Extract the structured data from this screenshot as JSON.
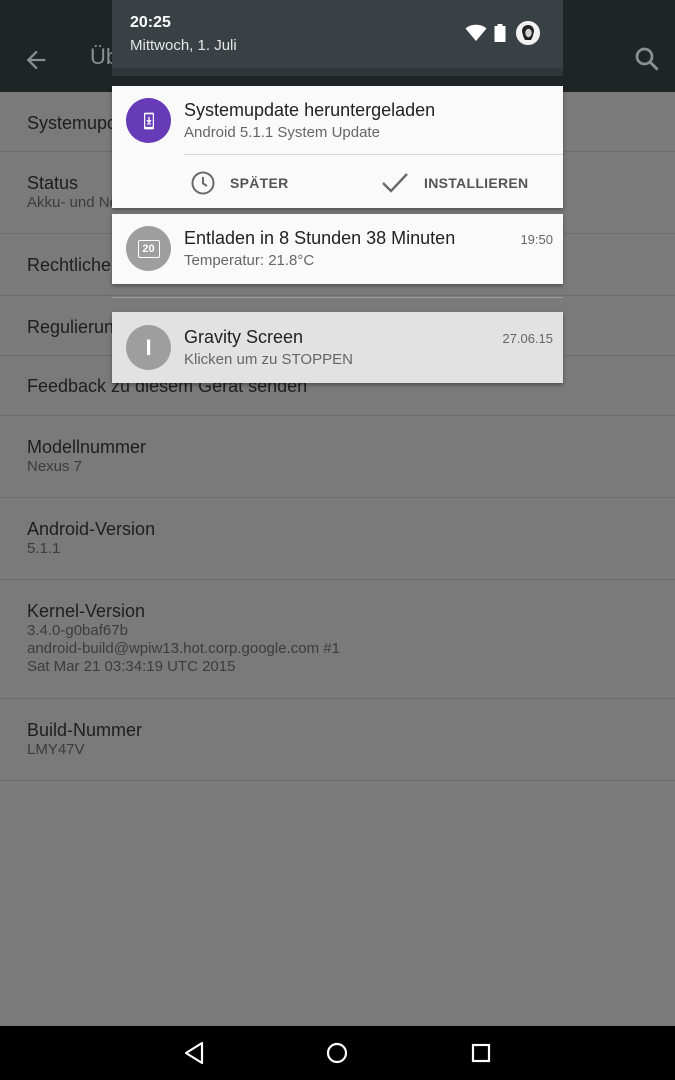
{
  "background_screen": {
    "title": "Üb",
    "items": [
      {
        "title": "Systemupd",
        "subtitle": ""
      },
      {
        "title": "Status",
        "subtitle": "Akku- und Netzwerkstatus und andere Informationen"
      },
      {
        "title": "Rechtliche",
        "subtitle": ""
      },
      {
        "title": "Regulierun",
        "subtitle": ""
      },
      {
        "title": "Feedback zu diesem Gerät senden",
        "subtitle": ""
      },
      {
        "title": "Modellnummer",
        "subtitle": "Nexus 7"
      },
      {
        "title": "Android-Version",
        "subtitle": "5.1.1"
      },
      {
        "title": "Kernel-Version",
        "subtitle": "3.4.0-g0baf67b",
        "subtitle2": "android-build@wpiw13.hot.corp.google.com #1",
        "subtitle3": "Sat Mar 21 03:34:19 UTC 2015"
      },
      {
        "title": "Build-Nummer",
        "subtitle": "LMY47V"
      }
    ]
  },
  "status": {
    "time": "20:25",
    "date": "Mittwoch, 1. Juli"
  },
  "notifications": {
    "update": {
      "title": "Systemupdate heruntergeladen",
      "subtitle": "Android 5.1.1 System Update",
      "icon": "system-update-icon",
      "icon_color": "#673AB7",
      "action_later": "SPÄTER",
      "action_install": "INSTALLIEREN"
    },
    "battery": {
      "title": "Entladen in 8 Stunden 38 Minuten",
      "subtitle": "Temperatur: 21.8°C",
      "time": "19:50",
      "icon_text": "20"
    },
    "gravity": {
      "title": "Gravity Screen",
      "subtitle": "Klicken um zu STOPPEN",
      "time": "27.06.15",
      "icon_text": "I"
    }
  }
}
